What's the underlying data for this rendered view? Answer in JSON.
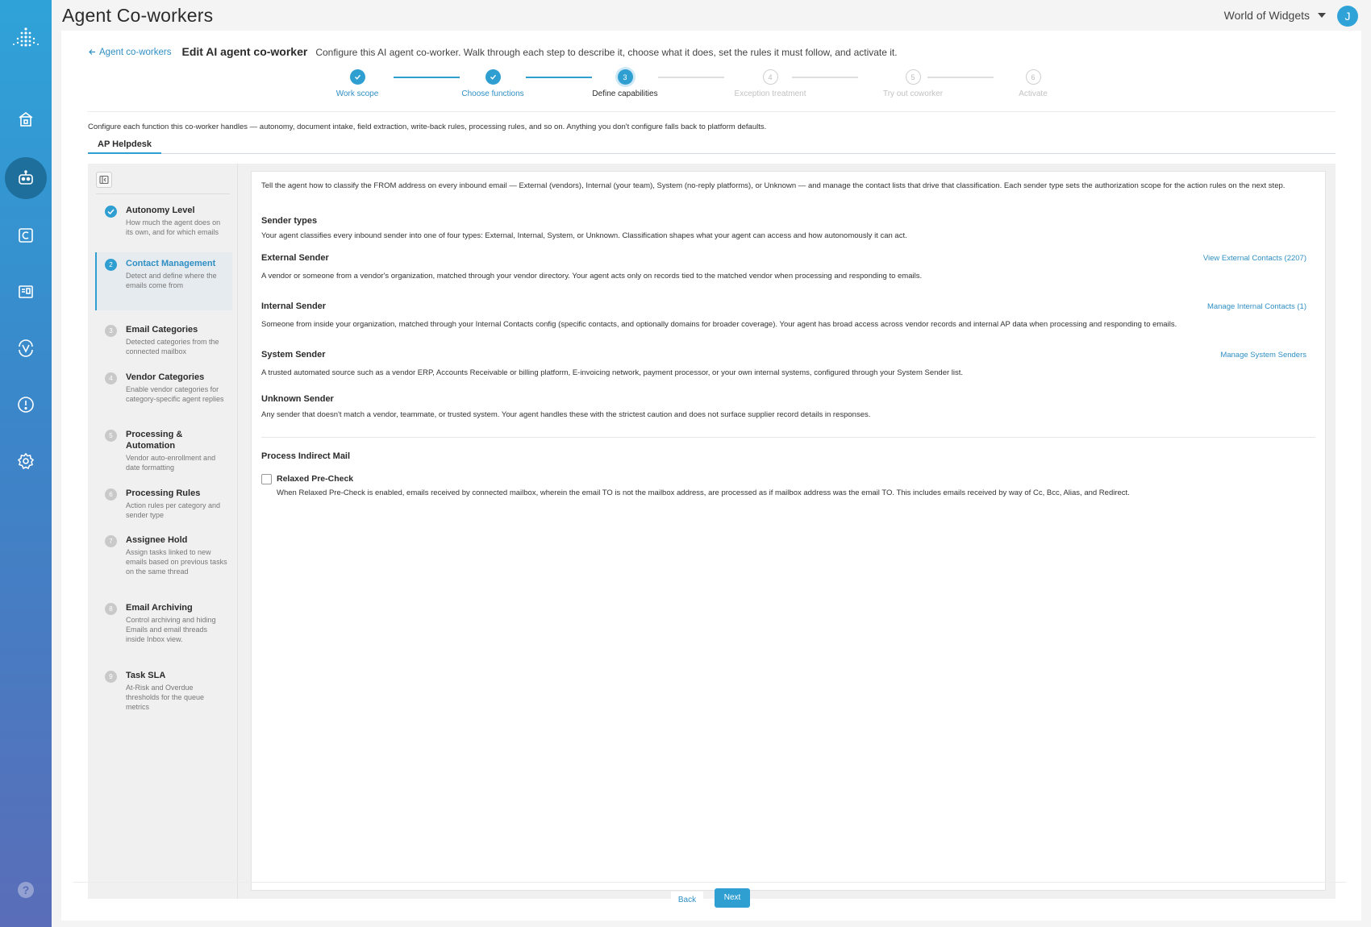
{
  "header": {
    "title": "Agent Co-workers",
    "org": "World of Widgets",
    "avatar_initial": "J"
  },
  "crumb": {
    "back_label": "Agent co-workers",
    "title": "Edit AI agent co-worker",
    "description": "Configure this AI agent co-worker. Walk through each step to describe it, choose what it does, set the rules it must follow, and activate it."
  },
  "stepper": {
    "steps": [
      {
        "num": "1",
        "label": "Work scope",
        "state": "done"
      },
      {
        "num": "2",
        "label": "Choose functions",
        "state": "done"
      },
      {
        "num": "3",
        "label": "Define capabilities",
        "state": "current"
      },
      {
        "num": "4",
        "label": "Exception treatment",
        "state": "todo"
      },
      {
        "num": "5",
        "label": "Try out coworker",
        "state": "todo"
      },
      {
        "num": "6",
        "label": "Activate",
        "state": "todo"
      }
    ]
  },
  "intro": "Configure each function this co-worker handles — autonomy, document intake, field extraction, write-back rules, processing rules, and so on. Anything you don't configure falls back to platform defaults.",
  "tab": {
    "label": "AP Helpdesk"
  },
  "sidebar": {
    "items": [
      {
        "num": "",
        "title": "Autonomy Level",
        "desc": "How much the agent does on its own, and for which emails"
      },
      {
        "num": "2",
        "title": "Contact Management",
        "desc": "Detect and define where the emails come from"
      },
      {
        "num": "3",
        "title": "Email Categories",
        "desc": "Detected categories from the connected mailbox"
      },
      {
        "num": "4",
        "title": "Vendor Categories",
        "desc": "Enable vendor categories for category-specific agent replies"
      },
      {
        "num": "5",
        "title": "Processing & Automation",
        "desc": "Vendor auto-enrollment and date formatting"
      },
      {
        "num": "6",
        "title": "Processing Rules",
        "desc": "Action rules per category and sender type"
      },
      {
        "num": "7",
        "title": "Assignee Hold",
        "desc": "Assign tasks linked to new emails based on previous tasks on the same thread"
      },
      {
        "num": "8",
        "title": "Email Archiving",
        "desc": "Control archiving and hiding Emails and email threads inside Inbox view."
      },
      {
        "num": "9",
        "title": "Task SLA",
        "desc": "At-Risk and Overdue thresholds for the queue metrics"
      }
    ]
  },
  "content": {
    "intro": "Tell the agent how to classify the FROM address on every inbound email — External (vendors), Internal (your team), System (no-reply platforms), or Unknown — and manage the contact lists that drive that classification. Each sender type sets the authorization scope for the action rules on the next step.",
    "sender_types_title": "Sender types",
    "sender_types_desc": "Your agent classifies every inbound sender into one of four types: External, Internal, System, or Unknown. Classification shapes what your agent can access and how autonomously it can act.",
    "external": {
      "title": "External Sender",
      "link": "View External Contacts (2207)",
      "desc": "A vendor or someone from a vendor's organization, matched through your vendor directory. Your agent acts only on records tied to the matched vendor when processing and responding to emails."
    },
    "internal": {
      "title": "Internal Sender",
      "link": "Manage Internal Contacts (1)",
      "desc": "Someone from inside your organization, matched through your Internal Contacts config (specific contacts, and optionally domains for broader coverage). Your agent has broad access across vendor records and internal AP data when processing and responding to emails."
    },
    "system": {
      "title": "System Sender",
      "link": "Manage System Senders",
      "desc": "A trusted automated source such as a vendor ERP, Accounts Receivable or billing platform, E-invoicing network, payment processor, or your own internal systems, configured through your System Sender list."
    },
    "unknown": {
      "title": "Unknown Sender",
      "desc": "Any sender that doesn't match a vendor, teammate, or trusted system. Your agent handles these with the strictest caution and does not surface supplier record details in responses."
    },
    "indirect": {
      "title": "Process Indirect Mail",
      "checkbox_label": "Relaxed Pre-Check",
      "checkbox_desc": "When Relaxed Pre-Check is enabled, emails received by connected mailbox, wherein the email TO is not the mailbox address, are processed as if mailbox address was the email TO. This includes emails received by way of Cc, Bcc, Alias, and Redirect."
    }
  },
  "footer": {
    "back_label": "Back",
    "next_label": "Next"
  },
  "colors": {
    "accent": "#2f9fd2",
    "link": "#2f8fc4",
    "rail_top": "#2fa3d8",
    "rail_bottom": "#5a6db8"
  }
}
